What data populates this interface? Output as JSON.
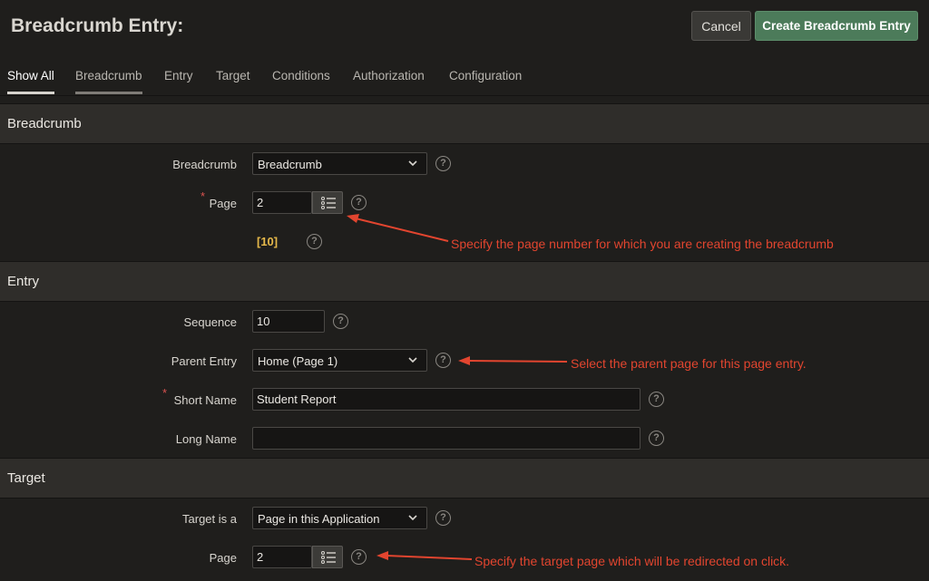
{
  "header": {
    "title": "Breadcrumb Entry:",
    "cancel_label": "Cancel",
    "create_label": "Create Breadcrumb Entry"
  },
  "tabs": [
    {
      "label": "Show All"
    },
    {
      "label": "Breadcrumb"
    },
    {
      "label": "Entry"
    },
    {
      "label": "Target"
    },
    {
      "label": "Conditions"
    },
    {
      "label": "Authorization"
    },
    {
      "label": "Configuration"
    }
  ],
  "sections": {
    "breadcrumb": {
      "title": "Breadcrumb",
      "breadcrumb_label": "Breadcrumb",
      "breadcrumb_value": "Breadcrumb",
      "page_label": "Page",
      "page_value": "2",
      "page_ref": "[10]"
    },
    "entry": {
      "title": "Entry",
      "sequence_label": "Sequence",
      "sequence_value": "10",
      "parent_label": "Parent Entry",
      "parent_value": "Home (Page 1)",
      "short_name_label": "Short Name",
      "short_name_value": "Student Report",
      "long_name_label": "Long Name",
      "long_name_value": ""
    },
    "target": {
      "title": "Target",
      "target_is_label": "Target is a",
      "target_is_value": "Page in this Application",
      "page_label": "Page",
      "page_value": "2"
    }
  },
  "required_mark": "*",
  "help_glyph": "?",
  "annotations": {
    "page": "Specify the page number for which you are creating the breadcrumb",
    "parent": "Select the parent page for this page entry.",
    "target": "Specify the target page which will be redirected on click."
  },
  "colors": {
    "accent_green": "#4c7b5a",
    "annotation_red": "#e2452f",
    "page_ref_gold": "#e6b94a"
  }
}
